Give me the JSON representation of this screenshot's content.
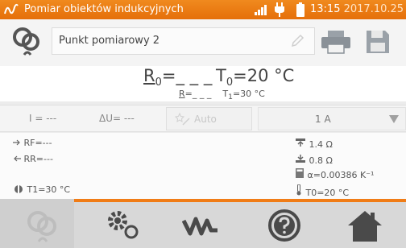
{
  "statusbar": {
    "title": "Pomiar obiektów indukcyjnych",
    "time": "13:15",
    "date": "2017.10.25"
  },
  "point": {
    "name": "Punkt pomiarowy 2"
  },
  "result": {
    "r0_label": "R",
    "r0_sub": "0",
    "r0_value": "=_ _ _",
    "t0_label": "T",
    "t0_sub": "0",
    "t0_value": "=20 °C",
    "r_label": "R",
    "r_value": "=_ _ _",
    "t1_label": "T",
    "t1_sub": "1",
    "t1_value": "=30 °C"
  },
  "params": {
    "current": "I = ---",
    "voltage": "ΔU= ---",
    "auto_label": "Auto",
    "range": "1 A"
  },
  "info": {
    "rf": "RF=---",
    "rr": "RR=---",
    "t1": "T1=30 °C",
    "limit_high": "1.4 Ω",
    "limit_low": "0.8 Ω",
    "alpha": "α=0.00386 K⁻¹",
    "t0": "T0=20 °C"
  },
  "colors": {
    "accent": "#f07c16",
    "statusbar": "#e97710",
    "navbar": "#d8d8d8"
  },
  "icons": {
    "mode": "inductance-mode-icon",
    "print": "printer-icon",
    "save": "floppy-disk-icon",
    "settings": "gears-icon",
    "wave": "waveform-icon",
    "help": "help-icon",
    "home": "home-icon"
  }
}
